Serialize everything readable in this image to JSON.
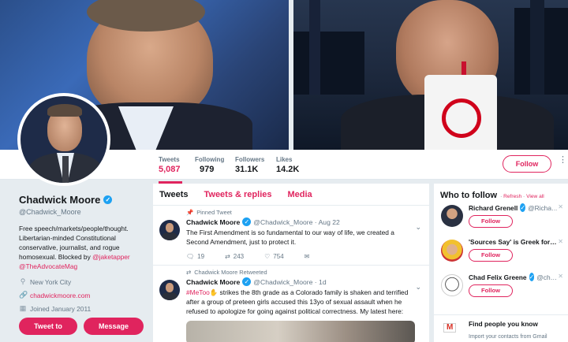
{
  "stats": [
    {
      "label": "Tweets",
      "value": "5,087",
      "active": true
    },
    {
      "label": "Following",
      "value": "979"
    },
    {
      "label": "Followers",
      "value": "31.1K"
    },
    {
      "label": "Likes",
      "value": "14.2K"
    }
  ],
  "header": {
    "follow_label": "Follow",
    "more_glyph": "•\n•\n•"
  },
  "profile": {
    "name": "Chadwick Moore",
    "handle": "@Chadwick_Moore",
    "bio_text": "Free speech/markets/people/thought. Libertarian-minded Constitutional conservative, journalist, and rogue homosexual. Blocked by ",
    "bio_mention1": "@jaketapper",
    "bio_mention2": "@TheAdvocateMag",
    "location": "New York City",
    "website": "chadwickmoore.com",
    "joined": "Joined January 2011",
    "tweet_to_label": "Tweet to",
    "message_label": "Message"
  },
  "tabs": {
    "tweets": "Tweets",
    "replies": "Tweets & replies",
    "media": "Media"
  },
  "tweets": [
    {
      "context": "Pinned Tweet",
      "name": "Chadwick Moore",
      "handle": "@Chadwick_Moore · Aug 22",
      "text": "The First Amendment is so fundamental to our way of life, we created a Second Amendment, just to protect it.",
      "replies": "19",
      "retweets": "243",
      "likes": "754"
    },
    {
      "context": "Chadwick Moore Retweeted",
      "name": "Chadwick Moore",
      "handle": "@Chadwick_Moore · 1d",
      "hashtag": "#MeToo",
      "text": " strikes the 8th grade as a Colorado family is shaken and terrified after a group of preteen girls accused this 13yo of sexual assault when he refused to apologize for going against political correctness. My latest here:"
    }
  ],
  "who_to_follow": {
    "title": "Who to follow",
    "refresh": "Refresh",
    "view_all": "View all",
    "suggestions": [
      {
        "name": "Richard Grenell",
        "handle": "@Richa…",
        "verified": true,
        "follow": "Follow"
      },
      {
        "name": "'Sources Say' is Greek for…",
        "handle": "",
        "verified": false,
        "follow": "Follow"
      },
      {
        "name": "Chad Felix Greene",
        "handle": "@ch…",
        "verified": true,
        "follow": "Follow"
      }
    ],
    "find_title": "Find people you know",
    "find_sub": "Import your contacts from Gmail"
  }
}
